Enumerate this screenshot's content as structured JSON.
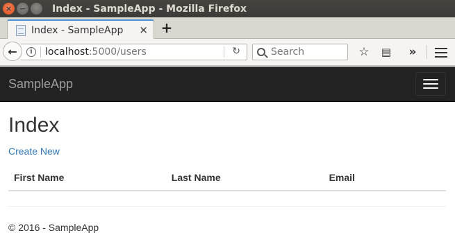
{
  "window": {
    "title": "Index - SampleApp - Mozilla Firefox",
    "close_glyph": "×",
    "minimize_glyph": "−",
    "maximize_glyph": ""
  },
  "tabs": [
    {
      "title": "Index - SampleApp",
      "close_glyph": "×",
      "active": true
    }
  ],
  "new_tab_glyph": "+",
  "navbar": {
    "back_glyph": "←",
    "info_glyph": "i",
    "url_host": "localhost",
    "url_rest": ":5000/users",
    "reload_glyph": "↻",
    "search_placeholder": "Search",
    "bookmark_glyph": "☆",
    "reader_glyph": "▤",
    "overflow_glyph": "»"
  },
  "app": {
    "brand": "SampleApp",
    "page_title": "Index",
    "create_link": "Create New",
    "table_headers": [
      "First Name",
      "Last Name",
      "Email"
    ],
    "table_rows": [],
    "footer": "© 2016 - SampleApp"
  },
  "colors": {
    "navbar_bg": "#222222",
    "brand_text": "#9d9d9d",
    "link": "#337ab7",
    "tab_accent": "#4a90d9",
    "titlebar_bg": "#3c3b37",
    "close_button": "#df4b16"
  },
  "icons": {
    "back": "back-arrow-icon",
    "info": "info-icon",
    "reload": "reload-icon",
    "search": "search-icon",
    "bookmark": "star-icon",
    "reader": "reader-view-icon",
    "overflow": "overflow-chevron-icon",
    "menu": "hamburger-menu-icon",
    "favicon": "page-favicon-icon"
  }
}
